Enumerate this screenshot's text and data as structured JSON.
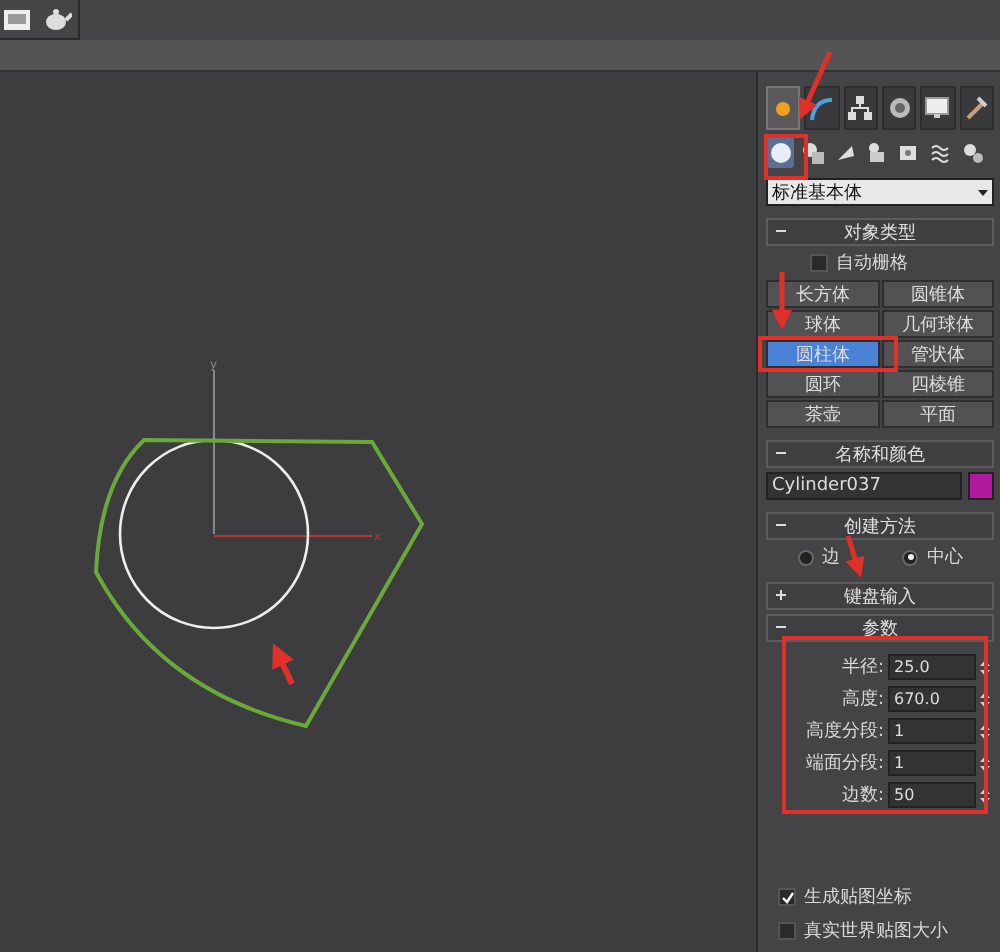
{
  "viewport": {
    "axis_labels": {
      "y": "y",
      "x": "x"
    }
  },
  "command_panel": {
    "tabs": [
      {
        "kind": "create",
        "selected": true
      },
      {
        "kind": "modify",
        "selected": false
      },
      {
        "kind": "hierarchy",
        "selected": false
      },
      {
        "kind": "motion",
        "selected": false
      },
      {
        "kind": "display",
        "selected": false
      },
      {
        "kind": "utilities",
        "selected": false
      }
    ],
    "categories": [
      {
        "kind": "geometry",
        "selected": true
      },
      {
        "kind": "shapes",
        "selected": false
      },
      {
        "kind": "lights",
        "selected": false
      },
      {
        "kind": "cameras",
        "selected": false
      },
      {
        "kind": "helpers",
        "selected": false
      },
      {
        "kind": "spacewarps",
        "selected": false
      },
      {
        "kind": "systems",
        "selected": false
      }
    ],
    "dropdown": {
      "value": "标准基本体"
    },
    "object_type": {
      "title": "对象类型",
      "expanded": true,
      "auto_grid": {
        "label": "自动栅格",
        "checked": false
      },
      "buttons": [
        {
          "label": "长方体",
          "selected": false
        },
        {
          "label": "圆锥体",
          "selected": false
        },
        {
          "label": "球体",
          "selected": false
        },
        {
          "label": "几何球体",
          "selected": false
        },
        {
          "label": "圆柱体",
          "selected": true
        },
        {
          "label": "管状体",
          "selected": false
        },
        {
          "label": "圆环",
          "selected": false
        },
        {
          "label": "四棱锥",
          "selected": false
        },
        {
          "label": "茶壶",
          "selected": false
        },
        {
          "label": "平面",
          "selected": false
        }
      ]
    },
    "name_and_color": {
      "title": "名称和颜色",
      "expanded": true,
      "name": "Cylinder037",
      "color": "#b0199e"
    },
    "creation_method": {
      "title": "创建方法",
      "expanded": true,
      "options": [
        {
          "label": "边",
          "selected": false
        },
        {
          "label": "中心",
          "selected": true
        }
      ]
    },
    "keyboard_entry": {
      "title": "键盘输入",
      "expanded": false
    },
    "parameters": {
      "title": "参数",
      "expanded": true,
      "fields": [
        {
          "label": "半径:",
          "value": "25.0"
        },
        {
          "label": "高度:",
          "value": "670.0"
        },
        {
          "label": "高度分段:",
          "value": "1"
        },
        {
          "label": "端面分段:",
          "value": "1"
        },
        {
          "label": "边数:",
          "value": "50"
        }
      ],
      "checkboxes": [
        {
          "label": "生成贴图坐标",
          "checked": true
        },
        {
          "label": "真实世界贴图大小",
          "checked": false
        }
      ]
    }
  }
}
